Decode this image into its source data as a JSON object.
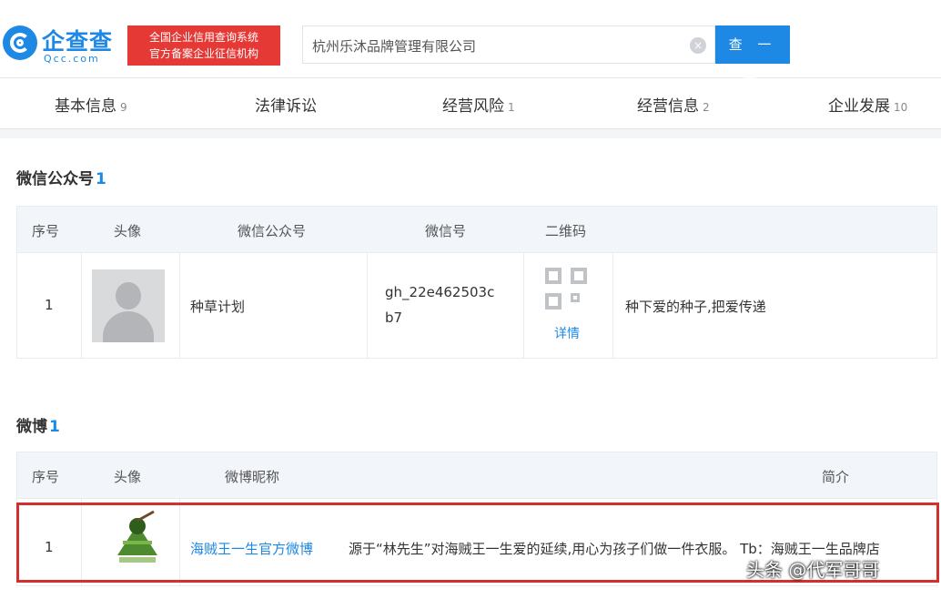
{
  "header": {
    "logo_text": "企查查",
    "logo_domain": "Qcc.com",
    "slogan_line1": "全国企业信用查询系统",
    "slogan_line2": "官方备案企业征信机构",
    "search_value": "杭州乐沐品牌管理有限公司",
    "clear_icon": "×",
    "search_button": "查 一 下"
  },
  "nav": {
    "items": [
      {
        "label": "基本信息",
        "count": "9"
      },
      {
        "label": "法律诉讼",
        "count": ""
      },
      {
        "label": "经营风险",
        "count": "1"
      },
      {
        "label": "经营信息",
        "count": "2"
      },
      {
        "label": "企业发展",
        "count": "10"
      }
    ]
  },
  "wechat": {
    "title": "微信公众号",
    "count": "1",
    "columns": [
      "序号",
      "头像",
      "微信公众号",
      "微信号",
      "二维码"
    ],
    "rows": [
      {
        "index": "1",
        "name": "种草计划",
        "id_line1": "gh_22e462503c",
        "id_line2": "b7",
        "detail": "详情",
        "intro": "种下爱的种子,把爱传递"
      }
    ]
  },
  "weibo": {
    "title": "微博",
    "count": "1",
    "columns": [
      "序号",
      "头像",
      "微博昵称",
      "简介"
    ],
    "rows": [
      {
        "index": "1",
        "name": "海贼王一生官方微博",
        "intro": "源于“林先生”对海贼王一生爱的延续,用心为孩子们做一件衣服。 Tb：海贼王一生品牌店"
      }
    ]
  },
  "watermark": "头条 @代军哥哥",
  "colors": {
    "accent": "#1e88e5",
    "highlight": "#d32f2f",
    "slogan_bg": "#e53935"
  }
}
